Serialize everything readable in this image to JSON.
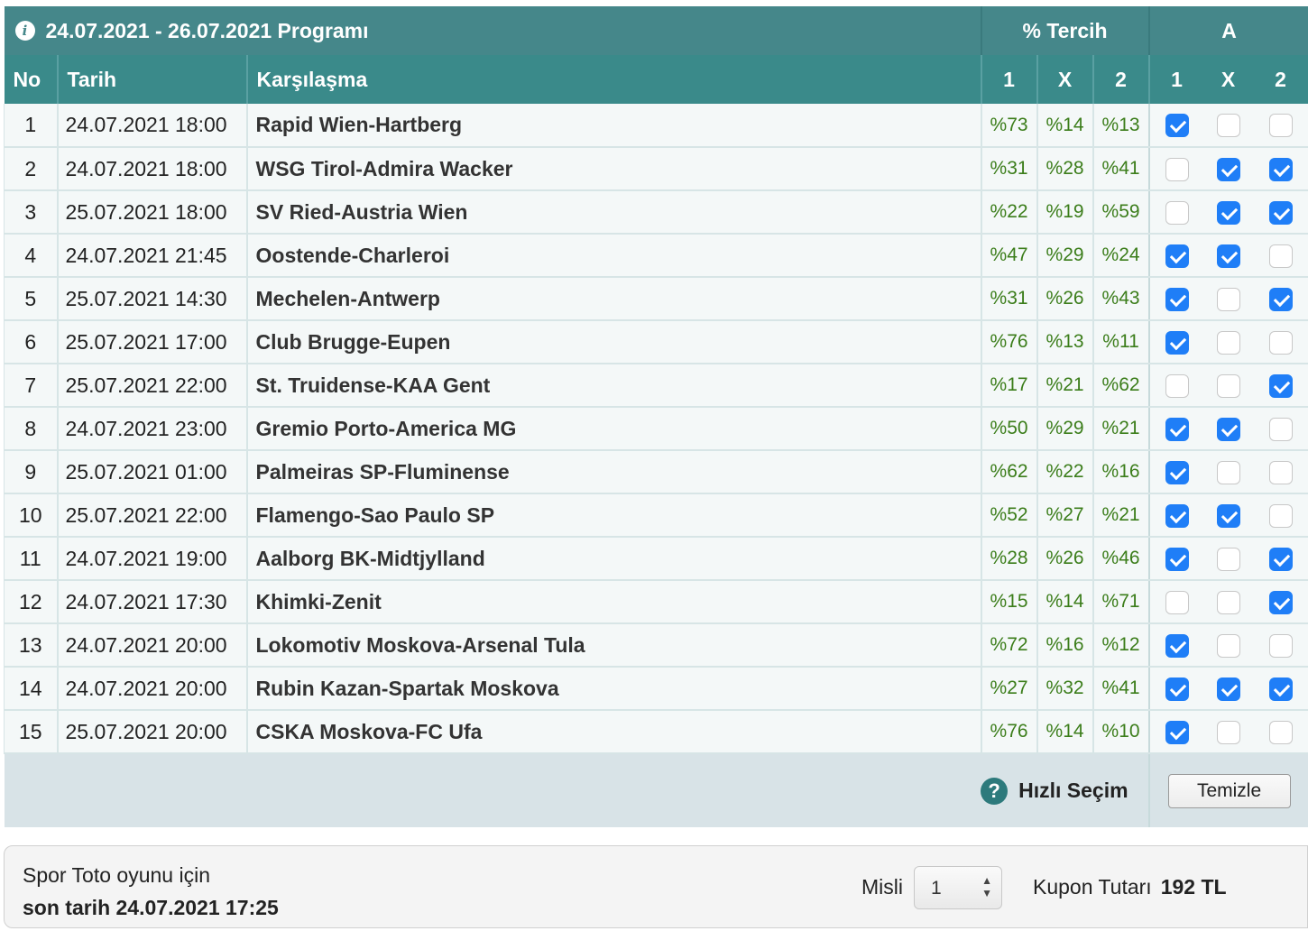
{
  "header": {
    "program_title": "24.07.2021 - 26.07.2021 Programı",
    "tercih_title": "% Tercih",
    "a_title": "A"
  },
  "columns": {
    "no": "No",
    "date": "Tarih",
    "match": "Karşılaşma",
    "p1": "1",
    "px": "X",
    "p2": "2",
    "a1": "1",
    "ax": "X",
    "a2": "2"
  },
  "rows": [
    {
      "no": "1",
      "date": "24.07.2021 18:00",
      "match": "Rapid Wien-Hartberg",
      "p1": "%73",
      "px": "%14",
      "p2": "%13",
      "c1": true,
      "cx": false,
      "c2": false
    },
    {
      "no": "2",
      "date": "24.07.2021 18:00",
      "match": "WSG Tirol-Admira Wacker",
      "p1": "%31",
      "px": "%28",
      "p2": "%41",
      "c1": false,
      "cx": true,
      "c2": true
    },
    {
      "no": "3",
      "date": "25.07.2021 18:00",
      "match": "SV Ried-Austria Wien",
      "p1": "%22",
      "px": "%19",
      "p2": "%59",
      "c1": false,
      "cx": true,
      "c2": true
    },
    {
      "no": "4",
      "date": "24.07.2021 21:45",
      "match": "Oostende-Charleroi",
      "p1": "%47",
      "px": "%29",
      "p2": "%24",
      "c1": true,
      "cx": true,
      "c2": false
    },
    {
      "no": "5",
      "date": "25.07.2021 14:30",
      "match": "Mechelen-Antwerp",
      "p1": "%31",
      "px": "%26",
      "p2": "%43",
      "c1": true,
      "cx": false,
      "c2": true
    },
    {
      "no": "6",
      "date": "25.07.2021 17:00",
      "match": "Club Brugge-Eupen",
      "p1": "%76",
      "px": "%13",
      "p2": "%11",
      "c1": true,
      "cx": false,
      "c2": false
    },
    {
      "no": "7",
      "date": "25.07.2021 22:00",
      "match": "St. Truidense-KAA Gent",
      "p1": "%17",
      "px": "%21",
      "p2": "%62",
      "c1": false,
      "cx": false,
      "c2": true
    },
    {
      "no": "8",
      "date": "24.07.2021 23:00",
      "match": "Gremio Porto-America MG",
      "p1": "%50",
      "px": "%29",
      "p2": "%21",
      "c1": true,
      "cx": true,
      "c2": false
    },
    {
      "no": "9",
      "date": "25.07.2021 01:00",
      "match": "Palmeiras SP-Fluminense",
      "p1": "%62",
      "px": "%22",
      "p2": "%16",
      "c1": true,
      "cx": false,
      "c2": false
    },
    {
      "no": "10",
      "date": "25.07.2021 22:00",
      "match": "Flamengo-Sao Paulo SP",
      "p1": "%52",
      "px": "%27",
      "p2": "%21",
      "c1": true,
      "cx": true,
      "c2": false
    },
    {
      "no": "11",
      "date": "24.07.2021 19:00",
      "match": "Aalborg BK-Midtjylland",
      "p1": "%28",
      "px": "%26",
      "p2": "%46",
      "c1": true,
      "cx": false,
      "c2": true
    },
    {
      "no": "12",
      "date": "24.07.2021 17:30",
      "match": "Khimki-Zenit",
      "p1": "%15",
      "px": "%14",
      "p2": "%71",
      "c1": false,
      "cx": false,
      "c2": true
    },
    {
      "no": "13",
      "date": "24.07.2021 20:00",
      "match": "Lokomotiv Moskova-Arsenal Tula",
      "p1": "%72",
      "px": "%16",
      "p2": "%12",
      "c1": true,
      "cx": false,
      "c2": false
    },
    {
      "no": "14",
      "date": "24.07.2021 20:00",
      "match": "Rubin Kazan-Spartak Moskova",
      "p1": "%27",
      "px": "%32",
      "p2": "%41",
      "c1": true,
      "cx": true,
      "c2": true
    },
    {
      "no": "15",
      "date": "25.07.2021 20:00",
      "match": "CSKA Moskova-FC Ufa",
      "p1": "%76",
      "px": "%14",
      "p2": "%10",
      "c1": true,
      "cx": false,
      "c2": false
    }
  ],
  "actions": {
    "quick_select_label": "Hızlı Seçim",
    "clear_label": "Temizle"
  },
  "footer": {
    "deadline_line1": "Spor Toto oyunu için",
    "deadline_line2": "son tarih 24.07.2021 17:25",
    "misli_label": "Misli",
    "misli_value": "1",
    "coupon_label": "Kupon Tutarı",
    "coupon_amount": "192 TL"
  },
  "colors": {
    "header_bg": "#45878a",
    "check_blue": "#1f7ef7",
    "pct_green": "#3b7d1a"
  }
}
